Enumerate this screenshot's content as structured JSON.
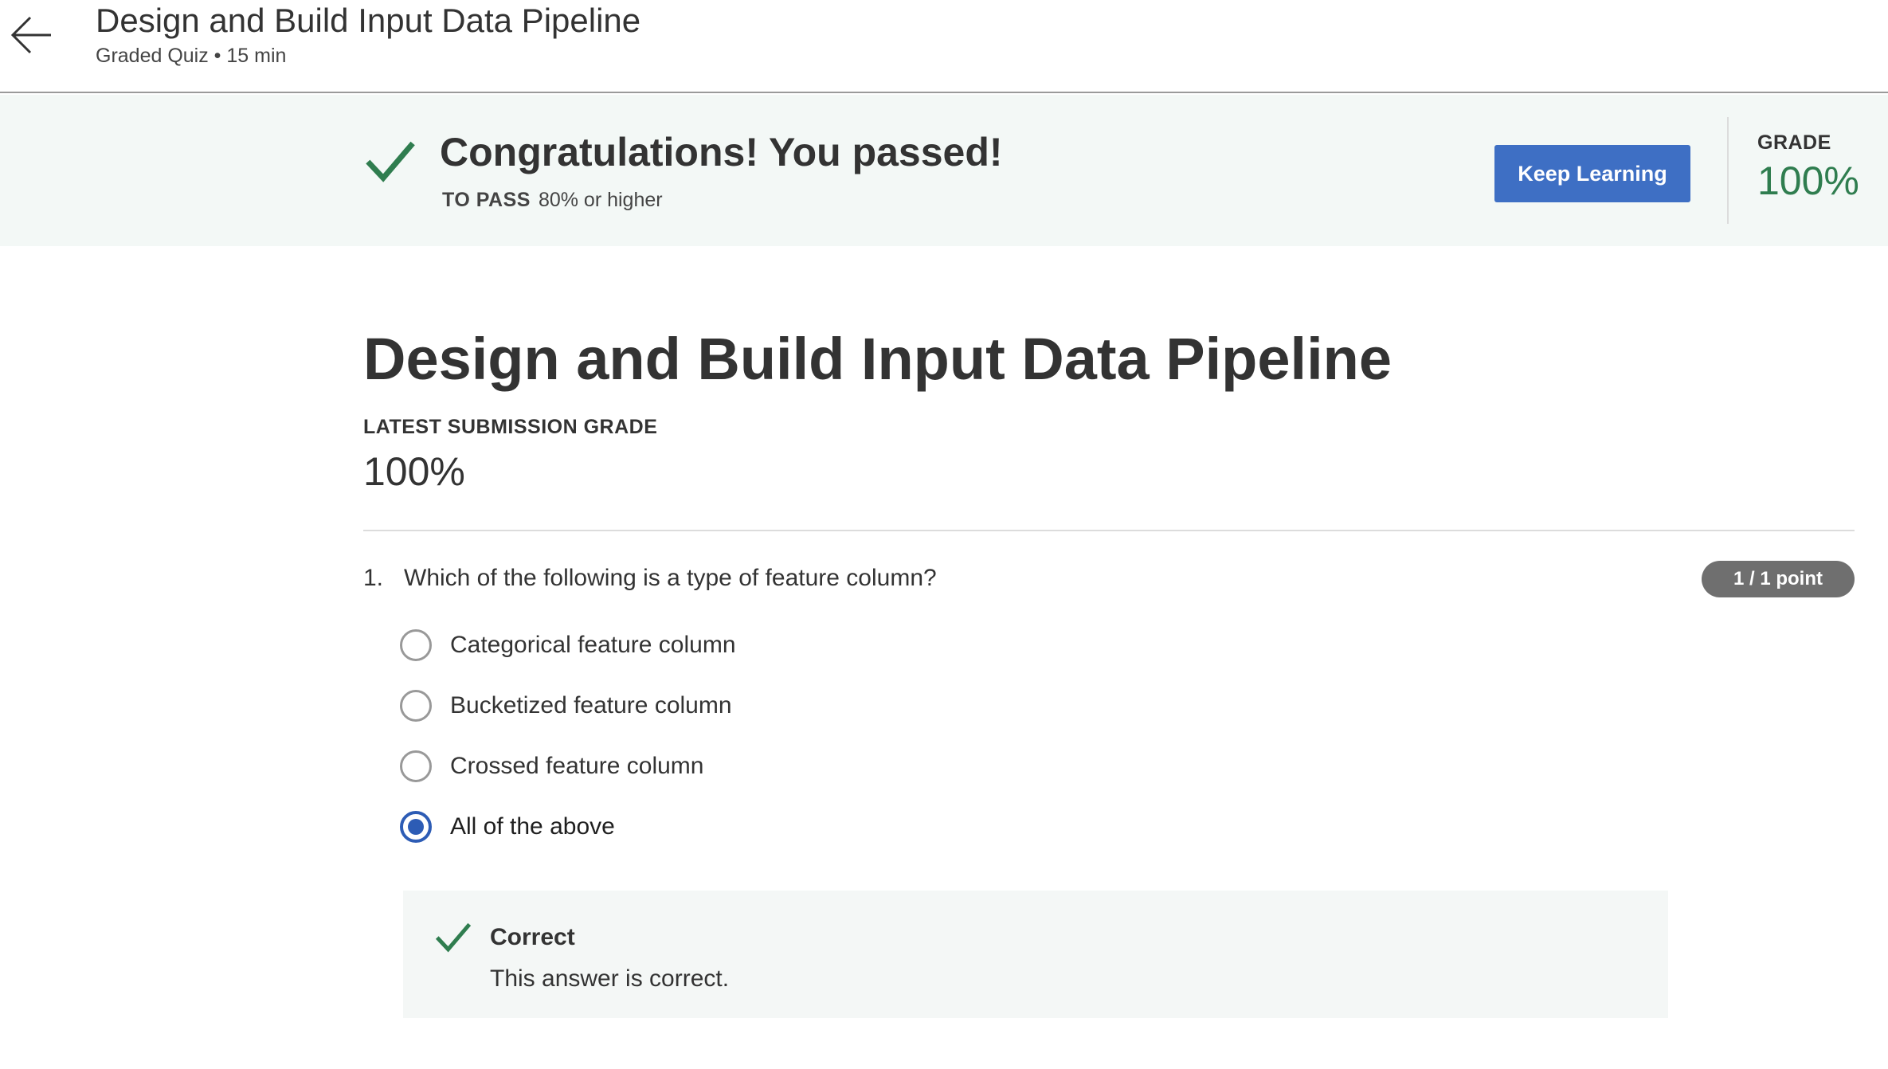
{
  "header": {
    "title": "Design and Build Input Data Pipeline",
    "subtitle": "Graded Quiz • 15 min"
  },
  "banner": {
    "message": "Congratulations! You passed!",
    "to_pass_label": "TO PASS",
    "to_pass_value": "80% or higher",
    "keep_learning_label": "Keep Learning",
    "grade_label": "GRADE",
    "grade_value": "100%"
  },
  "main": {
    "title": "Design and Build Input Data Pipeline",
    "latest_submission_label": "LATEST SUBMISSION GRADE",
    "latest_submission_value": "100%"
  },
  "question": {
    "number": "1.",
    "text": "Which of the following is a type of feature column?",
    "points": "1 / 1 point",
    "options": [
      {
        "label": "Categorical feature column",
        "selected": false
      },
      {
        "label": "Bucketized feature column",
        "selected": false
      },
      {
        "label": "Crossed feature column",
        "selected": false
      },
      {
        "label": "All of the above",
        "selected": true
      }
    ],
    "feedback": {
      "status": "Correct",
      "message": "This answer is correct."
    }
  },
  "colors": {
    "success_green": "#2f7d4f",
    "primary_blue": "#3e6fc4",
    "radio_selected": "#2d5cb5",
    "banner_bg": "#f3f8f6"
  },
  "icons": {
    "back": "arrow-left-icon",
    "pass": "checkmark-icon",
    "feedback": "checkmark-icon"
  }
}
